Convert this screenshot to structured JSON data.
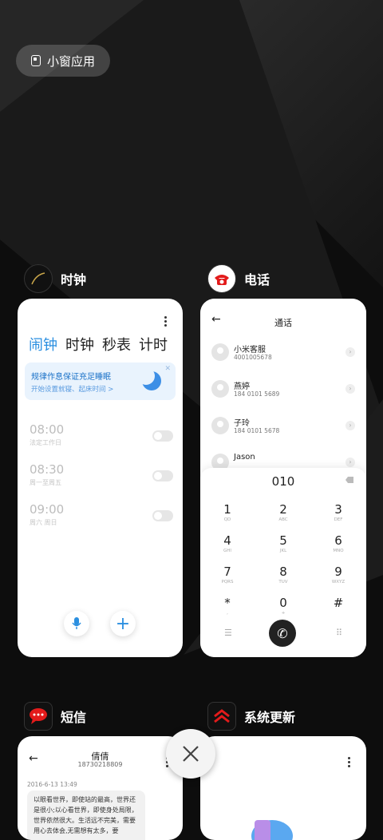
{
  "small_window_button": "小窗应用",
  "apps": {
    "clock": {
      "name": "时钟",
      "tabs": [
        "闹钟",
        "时钟",
        "秒表",
        "计时"
      ],
      "banner": {
        "title": "规律作息保证充足睡眠",
        "subtitle": "开始设置就寝、起床时间 >"
      },
      "alarms": [
        {
          "time": "08:00",
          "repeat": "法定工作日",
          "enabled": false
        },
        {
          "time": "08:30",
          "repeat": "周一至周五",
          "enabled": false
        },
        {
          "time": "09:00",
          "repeat": "周六 周日",
          "enabled": false
        }
      ]
    },
    "phone": {
      "name": "电话",
      "title": "通话",
      "contacts": [
        {
          "name": "小米客服",
          "number": "4001005678"
        },
        {
          "name": "燕婷",
          "number": "184 0101 5689"
        },
        {
          "name": "子玲",
          "number": "184 0101 5678"
        },
        {
          "name": "Jason",
          "number": ""
        }
      ],
      "dial_display": "010",
      "keys": [
        {
          "d": "1",
          "l": "QD"
        },
        {
          "d": "2",
          "l": "ABC"
        },
        {
          "d": "3",
          "l": "DEF"
        },
        {
          "d": "4",
          "l": "GHI"
        },
        {
          "d": "5",
          "l": "JKL"
        },
        {
          "d": "6",
          "l": "MNO"
        },
        {
          "d": "7",
          "l": "PQRS"
        },
        {
          "d": "8",
          "l": "TUV"
        },
        {
          "d": "9",
          "l": "WXYZ"
        },
        {
          "d": "*",
          "l": ","
        },
        {
          "d": "0",
          "l": "+"
        },
        {
          "d": "#",
          "l": ""
        }
      ]
    },
    "sms": {
      "name": "短信",
      "contact_name": "倩倩",
      "contact_number": "18730218809",
      "date": "2016-6-13 13:49",
      "message": "以眼看世界，即使站的最高，世界还是很小;以心看世界，即使身处局限，世界依然很大。生活远不完美，需要用心去体会,无需想有太多，要"
    },
    "update": {
      "name": "系统更新"
    }
  },
  "colors": {
    "accent": "#2b8fe0",
    "phone_icon": "#e31b1b"
  }
}
